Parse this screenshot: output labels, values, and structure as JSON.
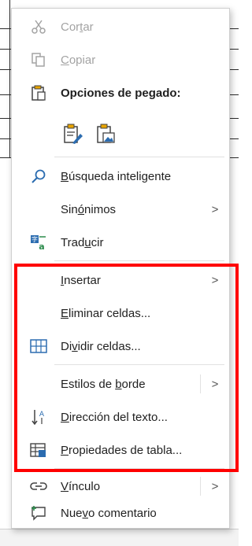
{
  "menu": {
    "items": {
      "cut": {
        "pre": "Cor",
        "key": "t",
        "post": "ar",
        "icon": "scissors-icon"
      },
      "copy": {
        "pre": "",
        "key": "C",
        "post": "opiar",
        "icon": "copy-icon"
      },
      "paste_options": {
        "label": "Opciones de pegado:",
        "icon": "clipboard-icon"
      },
      "paste_formats": [
        {
          "icon": "paste-keep-formatting-icon"
        },
        {
          "icon": "paste-picture-icon"
        }
      ],
      "smart_lookup": {
        "pre": "",
        "key": "B",
        "post": "úsqueda inteligente",
        "icon": "search-icon"
      },
      "synonyms": {
        "pre": "Sin",
        "key": "ó",
        "post": "nimos",
        "arrow": ">"
      },
      "translate": {
        "pre": "Trad",
        "key": "u",
        "post": "cir",
        "icon": "translate-icon"
      },
      "insert": {
        "pre": "",
        "key": "I",
        "post": "nsertar",
        "arrow": ">"
      },
      "delete_cells": {
        "pre": "",
        "key": "E",
        "post": "liminar celdas...",
        "icon": ""
      },
      "split_cells": {
        "pre": "Di",
        "key": "v",
        "post": "idir celdas...",
        "icon": "split-cells-icon"
      },
      "border_styles": {
        "pre": "Estilos de ",
        "key": "b",
        "post": "orde",
        "arrow": ">"
      },
      "text_direction": {
        "pre": "",
        "key": "D",
        "post": "irección del texto...",
        "icon": "text-direction-icon"
      },
      "table_properties": {
        "pre": "",
        "key": "P",
        "post": "ropiedades de tabla...",
        "icon": "table-properties-icon"
      },
      "link": {
        "pre": "",
        "key": "V",
        "post": "ínculo",
        "arrow": ">",
        "icon": "link-icon"
      },
      "new_comment": {
        "pre": "Nue",
        "key": "v",
        "post": "o comentario",
        "icon": "new-comment-icon"
      }
    },
    "highlight_color": "#ff0000",
    "accent_color": "#2b6cb0",
    "disabled_color": "#a3a3a3"
  }
}
